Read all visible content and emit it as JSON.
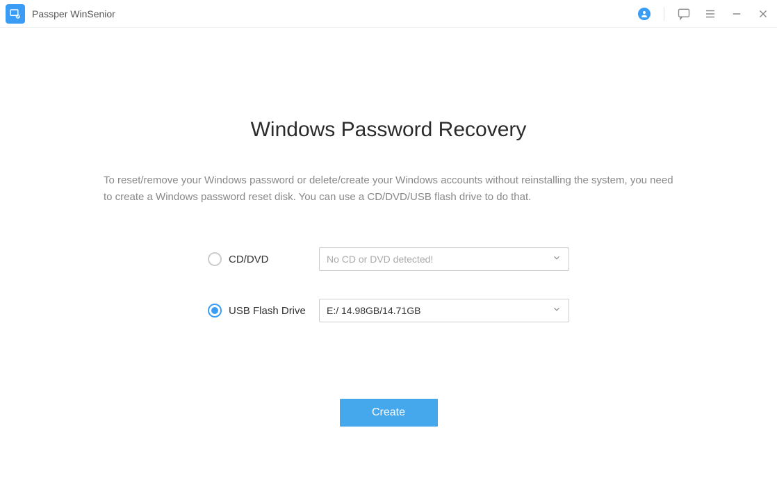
{
  "app": {
    "title": "Passper WinSenior"
  },
  "titlebar_icons": {
    "user": "user-icon",
    "feedback": "feedback-icon",
    "menu": "menu-icon",
    "minimize": "minimize-icon",
    "close": "close-icon"
  },
  "page": {
    "title": "Windows Password Recovery",
    "description": "To reset/remove your Windows password or delete/create your Windows accounts without reinstalling the system, you need to create a Windows password reset disk. You can use a CD/DVD/USB flash drive to do that."
  },
  "options": {
    "cd_dvd": {
      "label": "CD/DVD",
      "selected": false,
      "dropdown_placeholder": "No CD or DVD detected!",
      "dropdown_value": ""
    },
    "usb": {
      "label": "USB Flash Drive",
      "selected": true,
      "dropdown_value": "E:/ 14.98GB/14.71GB"
    }
  },
  "actions": {
    "create_label": "Create"
  }
}
